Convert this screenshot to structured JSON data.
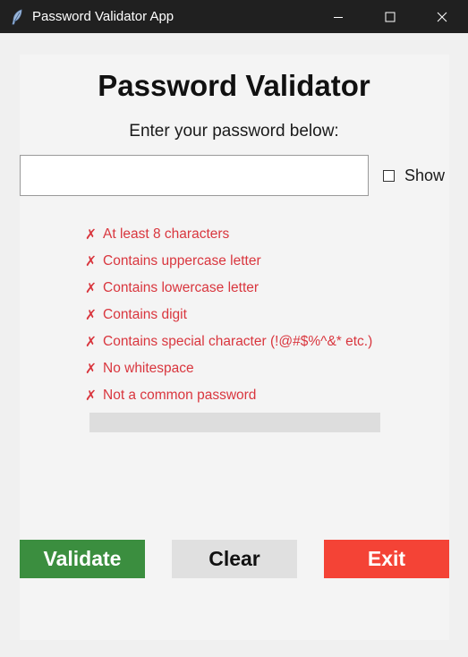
{
  "window": {
    "title": "Password Validator App",
    "titlebar_icon": "feather-icon",
    "controls": [
      "minimize-icon",
      "maximize-icon",
      "close-icon"
    ]
  },
  "heading": "Password Validator",
  "prompt": "Enter your password below:",
  "password_field": {
    "value": "",
    "placeholder": ""
  },
  "show_toggle": {
    "label": "Show",
    "checked": false
  },
  "criteria_mark": "✗",
  "criteria": [
    {
      "label": "At least 8 characters",
      "met": false
    },
    {
      "label": "Contains uppercase letter",
      "met": false
    },
    {
      "label": "Contains lowercase letter",
      "met": false
    },
    {
      "label": "Contains digit",
      "met": false
    },
    {
      "label": "Contains special character (!@#$%^&* etc.)",
      "met": false
    },
    {
      "label": "No whitespace",
      "met": false
    },
    {
      "label": "Not a common password",
      "met": false
    }
  ],
  "strength": {
    "progress": 0
  },
  "buttons": {
    "validate": "Validate",
    "clear": "Clear",
    "exit": "Exit"
  },
  "colors": {
    "titlebar_bg": "#202020",
    "criteria_unmet": "#d9363e",
    "validate_bg": "#3b8e3f",
    "validate_text": "#ffffff",
    "clear_bg": "#e0e0e0",
    "clear_text": "#111111",
    "exit_bg": "#f44336",
    "exit_text": "#ffffff",
    "strength_track": "#dddddd"
  }
}
